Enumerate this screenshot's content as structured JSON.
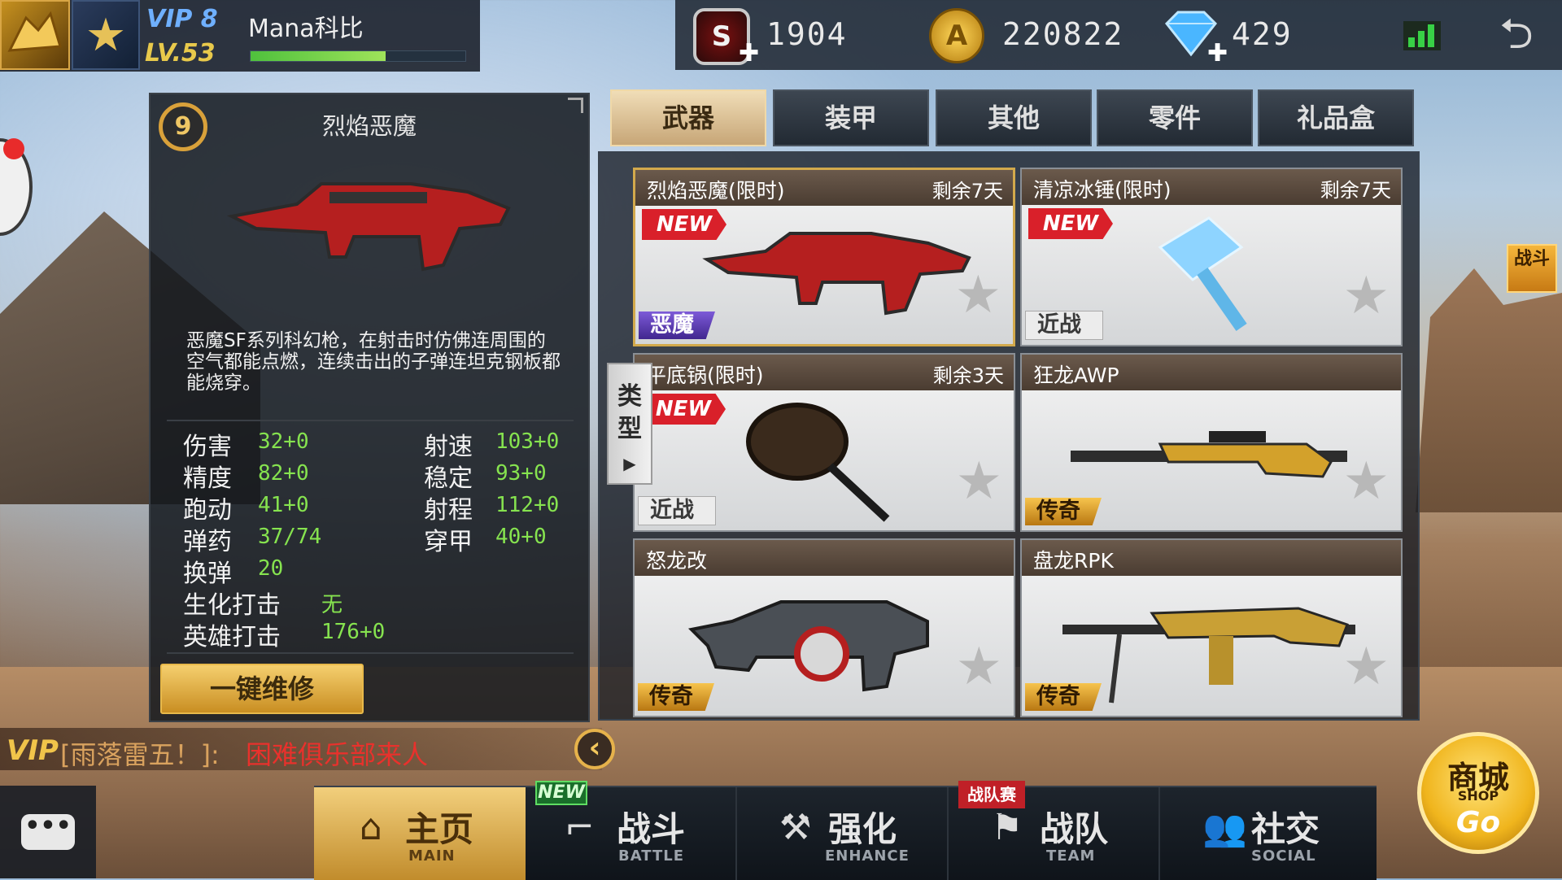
{
  "player": {
    "vip": "VIP 8",
    "level": "LV.53",
    "name": "Mana科比",
    "xp_fraction": 0.63
  },
  "currency": {
    "points": "1904",
    "gold": "220822",
    "diamonds": "429",
    "points_icon_letter": "S"
  },
  "detail": {
    "level_badge": "9",
    "weapon_name": "烈焰恶魔",
    "description": "恶魔SF系列科幻枪，在射击时仿佛连周围的空气都能点燃，连续击出的子弹连坦克钢板都能烧穿。",
    "stats_left": [
      {
        "label": "伤害",
        "value": "32+0"
      },
      {
        "label": "精度",
        "value": "82+0"
      },
      {
        "label": "跑动",
        "value": "41+0"
      },
      {
        "label": "弹药",
        "value": "37/74"
      },
      {
        "label": "换弹",
        "value": "20"
      },
      {
        "label": "生化打击",
        "value": "无"
      },
      {
        "label": "英雄打击",
        "value": "176+0"
      }
    ],
    "stats_right": [
      {
        "label": "射速",
        "value": "103+0"
      },
      {
        "label": "稳定",
        "value": "93+0"
      },
      {
        "label": "射程",
        "value": "112+0"
      },
      {
        "label": "穿甲",
        "value": "40+0"
      }
    ],
    "repair_button": "一键维修"
  },
  "tabs": [
    "武器",
    "装甲",
    "其他",
    "零件",
    "礼品盒"
  ],
  "type_tab": "类型",
  "items": [
    {
      "name": "烈焰恶魔(限时)",
      "remaining": "剩余7天",
      "new_label": "NEW",
      "tag": "恶魔"
    },
    {
      "name": "清凉冰锤(限时)",
      "remaining": "剩余7天",
      "new_label": "NEW",
      "tag": "近战"
    },
    {
      "name": "平底锅(限时)",
      "remaining": "剩余3天",
      "new_label": "NEW",
      "tag": "近战"
    },
    {
      "name": "狂龙AWP",
      "remaining": "",
      "new_label": "",
      "tag": "传奇"
    },
    {
      "name": "怒龙改",
      "remaining": "",
      "new_label": "",
      "tag": "传奇"
    },
    {
      "name": "盘龙RPK",
      "remaining": "",
      "new_label": "",
      "tag": "传奇"
    }
  ],
  "chat": {
    "vip": "VIP",
    "sender": "[雨落雷五！]:",
    "message": "困难俱乐部来人"
  },
  "nav": [
    {
      "label": "主页",
      "sub": "MAIN"
    },
    {
      "label": "战斗",
      "sub": "BATTLE"
    },
    {
      "label": "强化",
      "sub": "ENHANCE"
    },
    {
      "label": "战队",
      "sub": "TEAM"
    },
    {
      "label": "社交",
      "sub": "SOCIAL"
    }
  ],
  "badges": {
    "battle_new": "NEW",
    "team_event": "战队赛"
  },
  "side_battle": "战斗",
  "shop": {
    "title": "商城",
    "sub": "SHOP",
    "go": "Go"
  },
  "colors": {
    "accent_gold": "#d9a13a",
    "stat_green": "#86e34f",
    "new_red": "#d9202a",
    "chat_red": "#e9312c"
  }
}
